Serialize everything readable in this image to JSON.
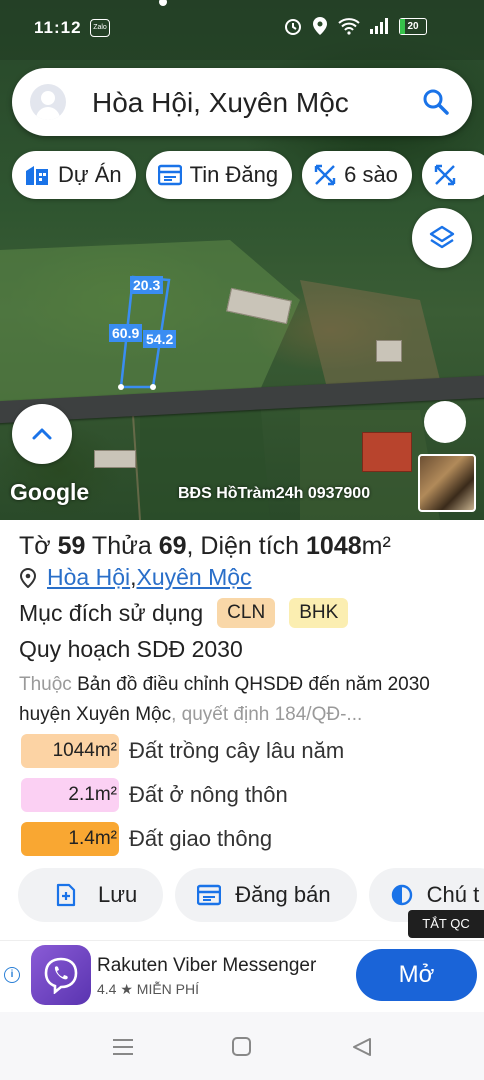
{
  "status_bar": {
    "time": "11:12",
    "zalo": "Zalo",
    "battery": "20"
  },
  "search": {
    "text": "Hòa Hội, Xuyên Mộc"
  },
  "chips": [
    {
      "label": "Dự Án",
      "icon": "building-icon"
    },
    {
      "label": "Tin Đăng",
      "icon": "listing-icon"
    },
    {
      "label": "6 sào",
      "icon": "measure-icon"
    }
  ],
  "map": {
    "plot_labels": {
      "top": "20.3",
      "left": "60.9",
      "right": "54.2"
    },
    "google": "Google",
    "watermark": "BĐS HồTràm24h 0937900"
  },
  "parcel": {
    "prefix_to": "Tờ ",
    "to_number": "59",
    "prefix_thua": " Thửa ",
    "thua_number": "69",
    "prefix_area": ", Diện tích ",
    "area_value": "1048",
    "area_unit": "m²",
    "location_ward": "Hòa Hội",
    "location_sep": ", ",
    "location_district": "Xuyên Mộc",
    "purpose_label": "Mục đích sử dụng",
    "purpose_badges": [
      {
        "code": "CLN",
        "color": "#f9d7a8"
      },
      {
        "code": "BHK",
        "color": "#fbeeb1"
      }
    ],
    "planning_title": "Quy hoạch SDĐ 2030",
    "planning_prefix": "Thuộc ",
    "planning_desc": "Bản đồ điều chỉnh QHSDĐ đến năm 2030 huyện Xuyên Mộc",
    "planning_suffix": ", quyết định 184/QĐ-...",
    "land_use": [
      {
        "area": "1044m²",
        "label": "Đất trồng cây lâu năm",
        "color": "#fcd3a4"
      },
      {
        "area": "2.1m²",
        "label": "Đất ở nông thôn",
        "color": "#fbd0f3"
      },
      {
        "area": "1.4m²",
        "label": "Đất giao thông",
        "color": "#f9a732"
      }
    ]
  },
  "actions": [
    {
      "label": "Lưu"
    },
    {
      "label": "Đăng bán"
    },
    {
      "label": "Chú t"
    }
  ],
  "ad": {
    "dismiss": "TẮT QC",
    "app_name": "Rakuten Viber Messenger",
    "rating": "4.4 ★ MIỄN PHÍ",
    "cta": "Mở"
  }
}
